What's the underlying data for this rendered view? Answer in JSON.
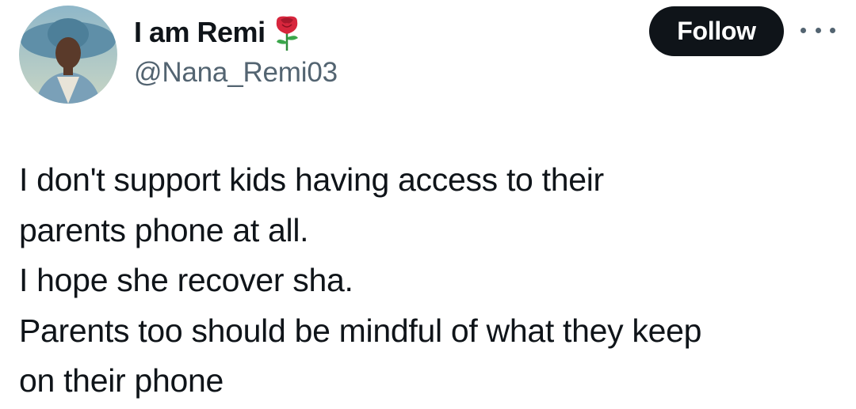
{
  "user": {
    "display_name": "I am Remi",
    "emoji_icon": "rose-icon",
    "handle": "@Nana_Remi03"
  },
  "actions": {
    "follow_label": "Follow",
    "more_icon": "more-horizontal-icon"
  },
  "tweet": {
    "lines": [
      "I don't support kids having access to their",
      "parents phone at all.",
      "I hope she recover sha.",
      "Parents too should be mindful of what they keep",
      "on their phone"
    ]
  },
  "colors": {
    "follow_bg": "#0f1419",
    "text": "#0f1419",
    "secondary": "#536471"
  }
}
